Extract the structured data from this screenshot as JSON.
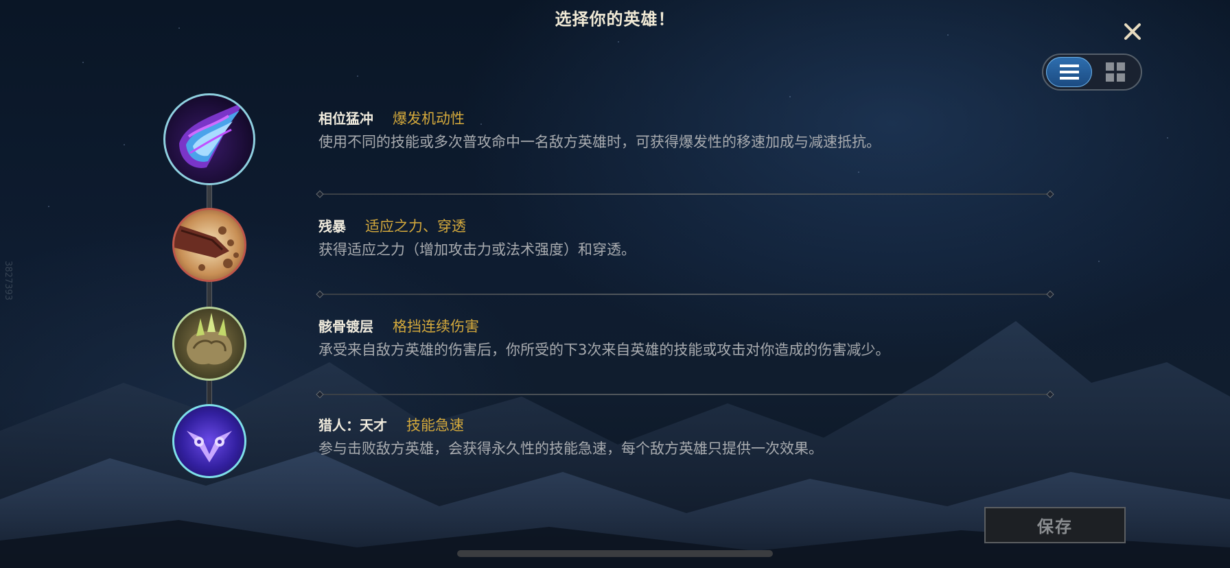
{
  "header": {
    "title": "选择你的英雄！"
  },
  "controls": {
    "close_icon": "close-icon",
    "view_modes": [
      {
        "name": "list-view",
        "icon": "list-icon",
        "active": true
      },
      {
        "name": "grid-view",
        "icon": "grid-icon",
        "active": false
      }
    ]
  },
  "runes": [
    {
      "name": "相位猛冲",
      "tag": "爆发机动性",
      "description": "使用不同的技能或多次普攻命中一名敌方英雄时，可获得爆发性的移速加成与减速抵抗。",
      "icon": "phase-rush-icon"
    },
    {
      "name": "残暴",
      "tag": "适应之力、穿透",
      "description": "获得适应之力（增加攻击力或法术强度）和穿透。",
      "icon": "brutal-icon"
    },
    {
      "name": "骸骨镀层",
      "tag": "格挡连续伤害",
      "description": "承受来自敌方英雄的伤害后，你所受的下3次来自英雄的技能或攻击对你造成的伤害减少。",
      "icon": "bone-plating-icon"
    },
    {
      "name": "猎人：天才",
      "tag": "技能急速",
      "description": "参与击败敌方英雄，会获得永久性的技能急速，每个敌方英雄只提供一次效果。",
      "icon": "ultimate-hunter-icon"
    }
  ],
  "footer": {
    "save_label": "保存"
  },
  "side_watermark": "3827393",
  "colors": {
    "tag": "#d4a93c",
    "name": "#f0ebdd",
    "description": "#a9acb0",
    "toggle_active": "#2e6fb0"
  }
}
